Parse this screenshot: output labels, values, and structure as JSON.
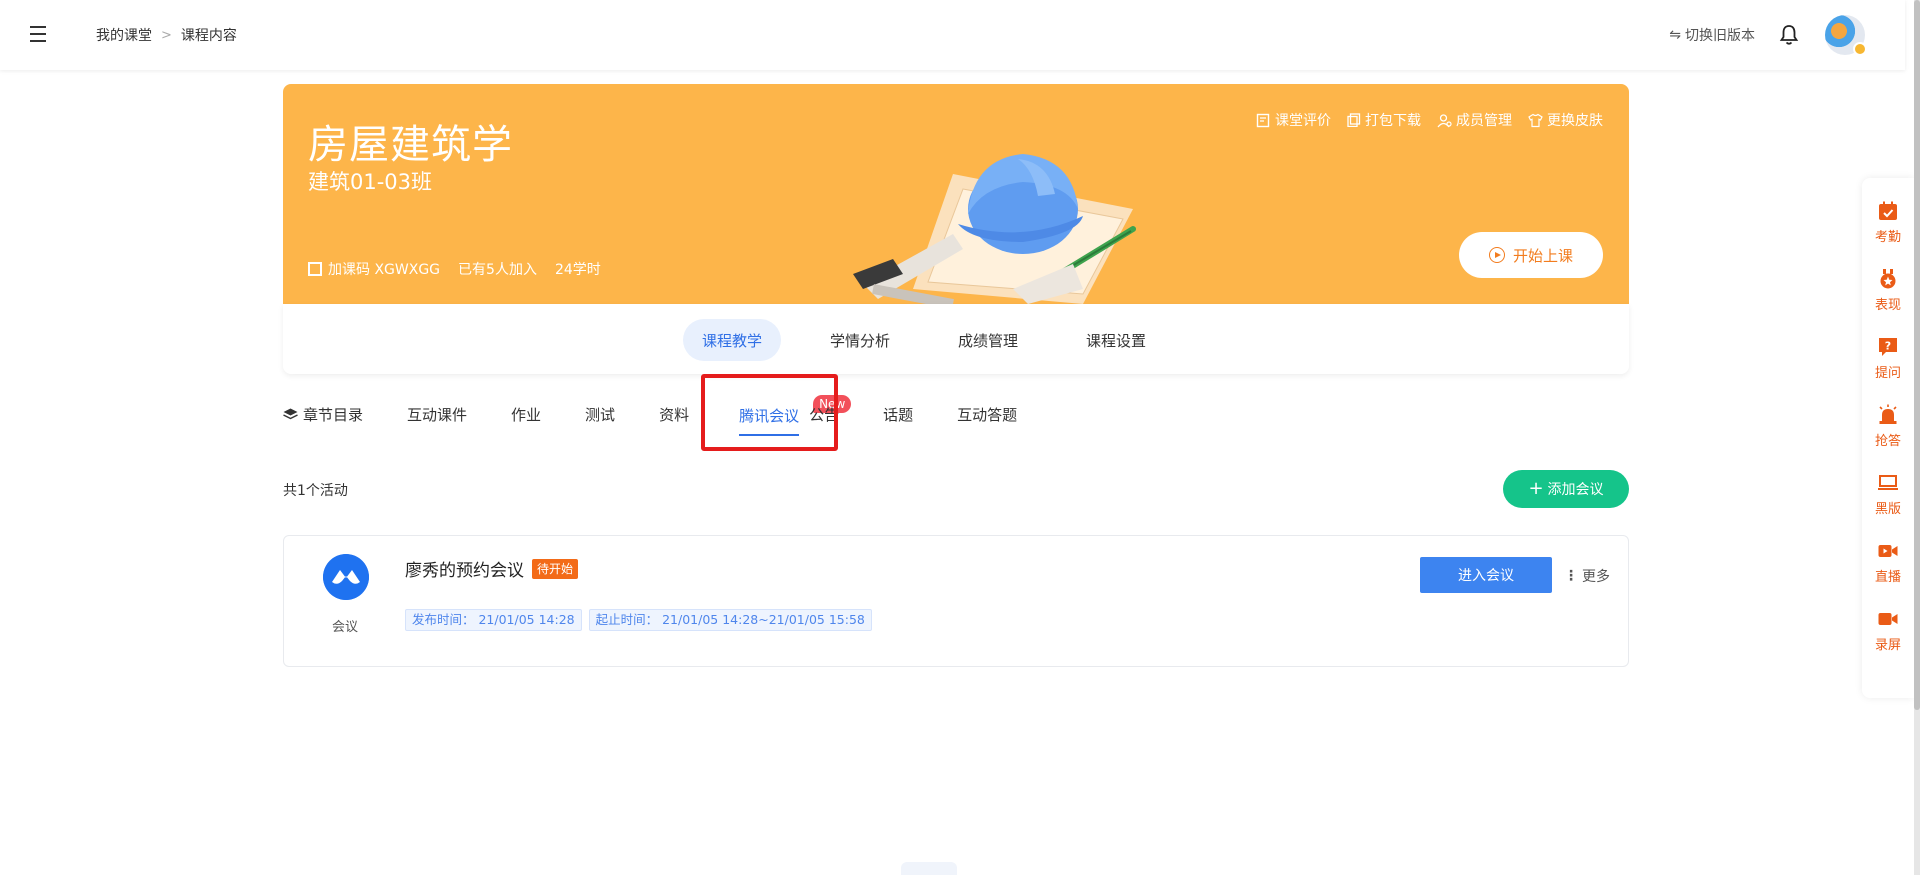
{
  "breadcrumb": {
    "home": "我的课堂",
    "current": "课程内容"
  },
  "topbar": {
    "switch_version": "切换旧版本"
  },
  "course": {
    "title": "房屋建筑学",
    "class_name": "建筑01-03班",
    "join_code": "加课码 XGWXGG",
    "members": "已有5人加入",
    "hours": "24学时"
  },
  "banner_actions": [
    "课堂评价",
    "打包下载",
    "成员管理",
    "更换皮肤"
  ],
  "start_class": "开始上课",
  "main_tabs": [
    "课程教学",
    "学情分析",
    "成绩管理",
    "课程设置"
  ],
  "sub_tabs": [
    "章节目录",
    "互动课件",
    "作业",
    "测试",
    "资料",
    "腾讯会议",
    "公告",
    "话题",
    "互动答题"
  ],
  "new_badge": "New",
  "activity_count": "共1个活动",
  "add_meeting": "添加会议",
  "meeting": {
    "type_label": "会议",
    "title": "廖秀的预约会议",
    "status": "待开始",
    "publish_time": "发布时间：  21/01/05 14:28",
    "period": "起止时间：  21/01/05 14:28~21/01/05 15:58",
    "enter": "进入会议",
    "more": "更多"
  },
  "rail": [
    "考勤",
    "表现",
    "提问",
    "抢答",
    "黑版",
    "直播",
    "录屏"
  ],
  "colors": {
    "banner": "#fdb54a",
    "accent": "#2f6fe6",
    "green": "#15c48a",
    "rail": "#ea5b16",
    "highlight_box": "#e51c1c"
  }
}
